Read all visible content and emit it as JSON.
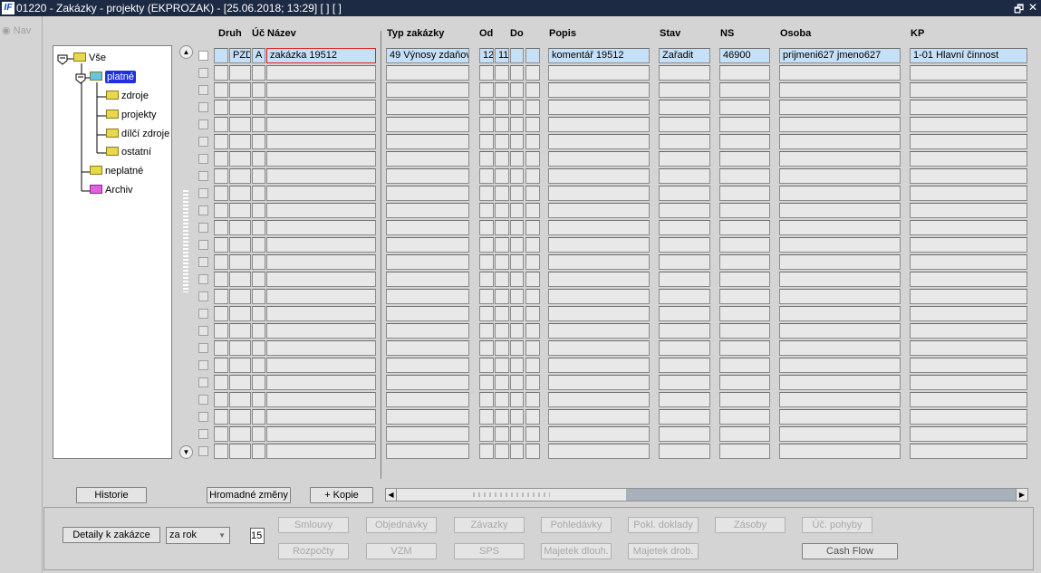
{
  "window": {
    "title": "01220 - Zakázky - projekty (EKPROZAK) - [25.06.2018; 13:29]  [ ]  [ ]",
    "logo": "IF",
    "restore_icon": "🗗",
    "close_icon": "✕"
  },
  "nav": {
    "label": "Nav"
  },
  "tree": {
    "root": "Vše",
    "platne": "platné",
    "zdroje": "zdroje",
    "projekty": "projekty",
    "dilci": "dílčí zdroje",
    "ostatni": "ostatní",
    "neplatne": "neplatné",
    "archiv": "Archiv"
  },
  "headers": {
    "druh": "Druh",
    "uc": "Úč",
    "nazev": "Název",
    "typ": "Typ zakázky",
    "od": "Od",
    "do": "Do",
    "popis": "Popis",
    "stav": "Stav",
    "ns": "NS",
    "osoba": "Osoba",
    "kp": "KP"
  },
  "grid": {
    "row_count": 24,
    "first_row": {
      "blank": "",
      "druh": "PZD",
      "uc": "A",
      "nazev": "zakázka 19512",
      "typ": "49 Výnosy zdaňov",
      "od1": "12",
      "od2": "11",
      "do1": "",
      "do2": "",
      "popis": "komentář 19512",
      "stav": "Zařadit",
      "ns": "46900",
      "osoba": "prijmeni627 jmeno627",
      "kp": "1-01 Hlavní činnost"
    }
  },
  "buttons": {
    "historie": "Historie",
    "hromadne": "Hromadné změny",
    "kopie": "+ Kopie",
    "detaily": "Detaily k zakázce",
    "smlouvy": "Smlouvy",
    "objednavky": "Objednávky",
    "zavazky": "Závazky",
    "pohledavky": "Pohledávky",
    "pokl": "Pokl. doklady",
    "zasoby": "Zásoby",
    "ucpohyby": "Úč. pohyby",
    "rozpocty": "Rozpočty",
    "vzm": "VZM",
    "sps": "SPS",
    "majdlouh": "Majetek dlouh.",
    "majdrob": "Majetek drob.",
    "cashflow": "Cash Flow"
  },
  "period": {
    "selected": "za rok",
    "number": "15"
  },
  "colors": {
    "titlebar": "#1c2a44",
    "active_row": "#c6e0f8",
    "selection": "#1e30e0"
  }
}
